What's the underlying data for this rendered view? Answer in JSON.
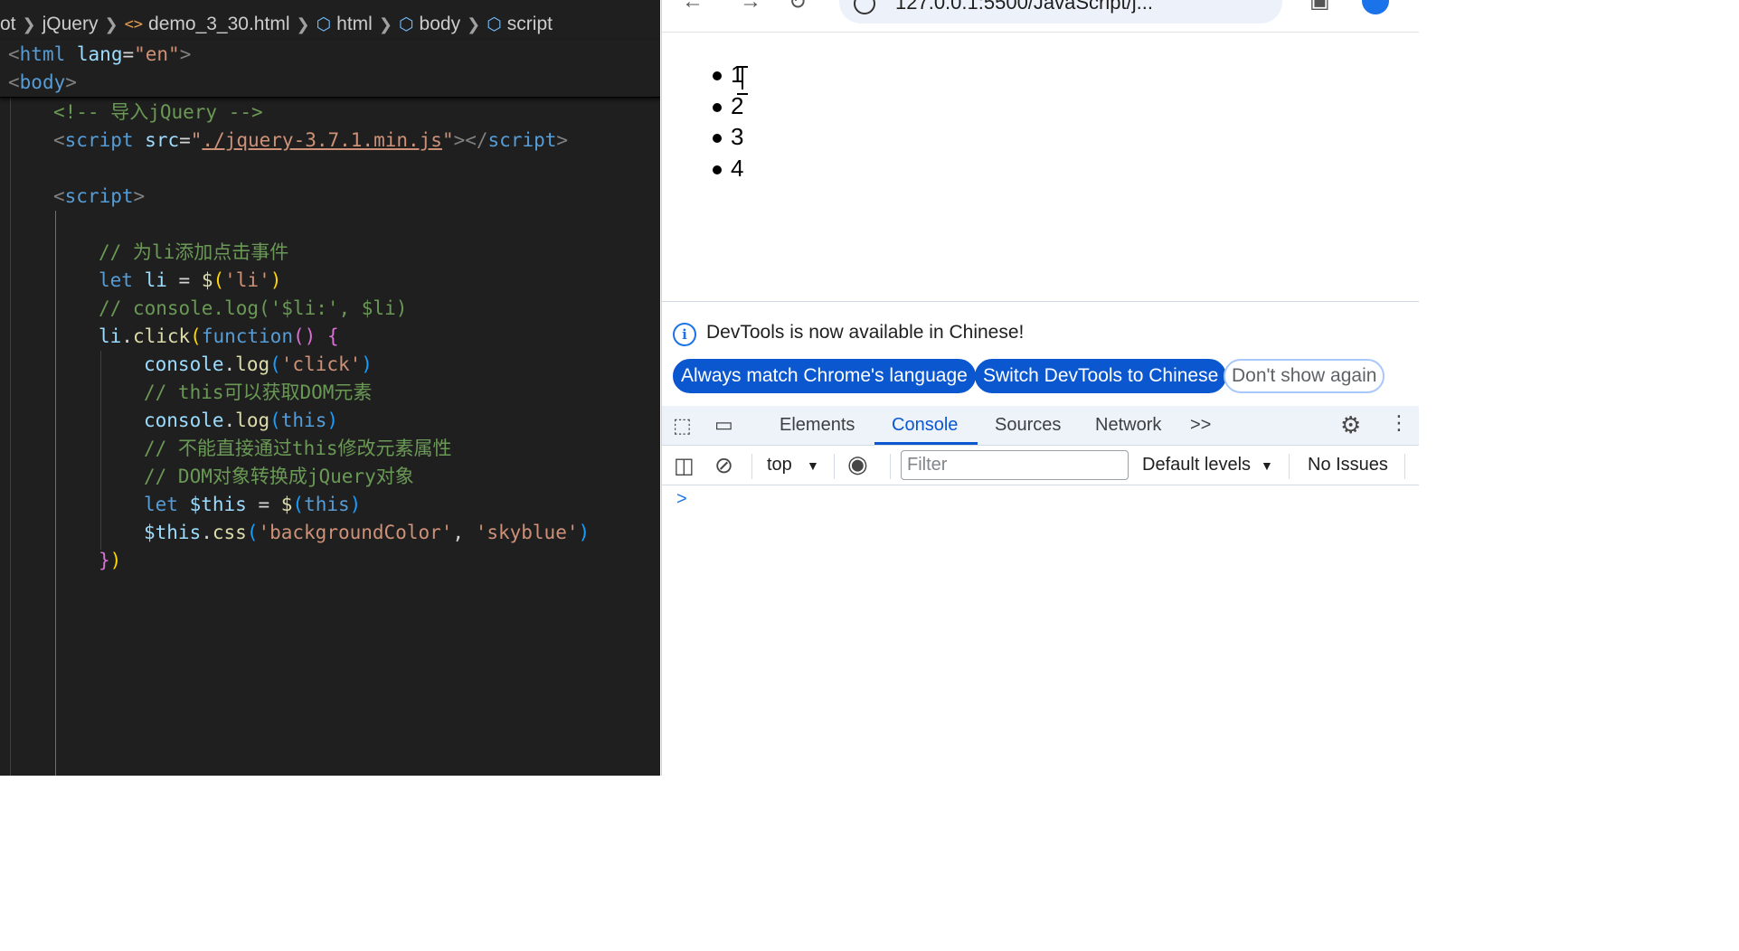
{
  "editor": {
    "breadcrumb": [
      {
        "label": "ot",
        "icon": ""
      },
      {
        "label": "jQuery",
        "icon": ""
      },
      {
        "label": "demo_3_30.html",
        "icon": "html-file-icon"
      },
      {
        "label": "html",
        "icon": "cube-icon"
      },
      {
        "label": "body",
        "icon": "cube-icon"
      },
      {
        "label": "script",
        "icon": "cube-icon"
      }
    ],
    "sticky_lines": {
      "l1": {
        "tag": "html",
        "attr": "lang",
        "value": "\"en\""
      },
      "l2": {
        "tag": "body"
      }
    },
    "code": {
      "comment_import": "<!-- 导入jQuery -->",
      "script_tag": "script",
      "src_attr": "src",
      "src_value": "./jquery-3.7.1.min.js",
      "comment_add_click": "// 为li添加点击事件",
      "let_kw": "let",
      "li_var": "li",
      "dollar": "$",
      "li_selector": "'li'",
      "comment_console_li": "// console.log('$li:', $li)",
      "li_obj": "li",
      "click_fn": "click",
      "function_kw": "function",
      "console": "console",
      "log": "log",
      "click_str": "'click'",
      "comment_this_dom": "// this可以获取DOM元素",
      "this_kw": "this",
      "comment_cannot_modify": "// 不能直接通过this修改元素属性",
      "comment_convert": "// DOM对象转换成jQuery对象",
      "this_var": "$this",
      "css_fn": "css",
      "css_prop": "'backgroundColor'",
      "css_value": "'skyblue'"
    }
  },
  "browser": {
    "address": "127.0.0.1:5500/JavaScript/j...",
    "page_list": [
      "1",
      "2",
      "3",
      "4"
    ],
    "devtools": {
      "info_text": "DevTools is now available in Chinese!",
      "buttons": {
        "match_language": "Always match Chrome's language",
        "switch_chinese": "Switch DevTools to Chinese",
        "dont_show": "Don't show again"
      },
      "tabs": [
        "Elements",
        "Console",
        "Sources",
        "Network"
      ],
      "active_tab": "Console",
      "more_tabs": ">>",
      "context": "top",
      "filter_placeholder": "Filter",
      "levels": "Default levels",
      "issues": "No Issues",
      "prompt": ">"
    }
  },
  "colors": {
    "editor_bg": "#1f1f1f",
    "accent": "#0b57d0",
    "tag": "#569cd6",
    "string": "#ce9178",
    "comment": "#6a9955"
  }
}
